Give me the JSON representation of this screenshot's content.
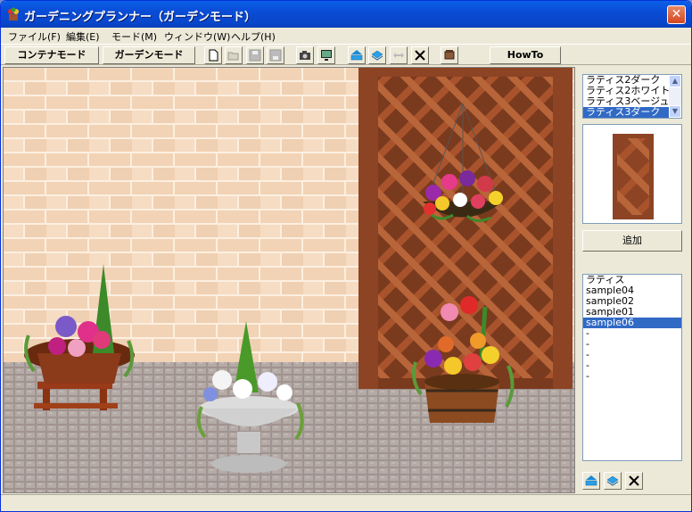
{
  "window": {
    "title": "ガーデニングプランナー（ガーデンモード）",
    "close_label": "✕"
  },
  "menu": {
    "items": [
      {
        "label": "ファイル(F)"
      },
      {
        "label": "編集(E)"
      },
      {
        "label": "モード(M)"
      },
      {
        "label": "ウィンドウ(W)"
      },
      {
        "label": "ヘルプ(H)"
      }
    ]
  },
  "toolbar": {
    "container_mode": "コンテナモード",
    "garden_mode": "ガーデンモード",
    "howto": "HowTo"
  },
  "parts_list": {
    "items": [
      "ラティス2ダーク",
      "ラティス2ホワイト",
      "ラティス3ベージュ",
      "ラティス3ダーク"
    ],
    "selected_index": 3
  },
  "add_button": "追加",
  "layer_list": {
    "items": [
      "ラティス",
      "sample04",
      "sample02",
      "sample01",
      "sample06",
      "-",
      "-",
      "-",
      "-",
      "-"
    ],
    "selected_index": 4
  },
  "colors": {
    "titlebar": "#0a4cd6",
    "selection": "#316ac5",
    "lattice": "#a9532c",
    "brick": "#f2d7be"
  }
}
